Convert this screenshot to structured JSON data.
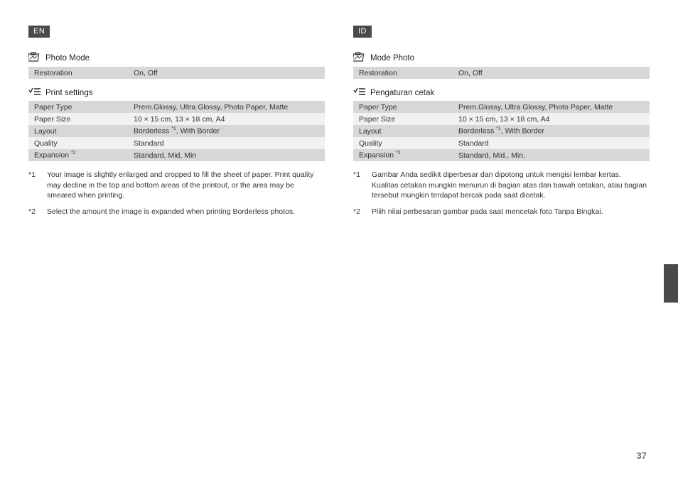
{
  "page_number": "37",
  "left": {
    "lang": "EN",
    "photo_mode": {
      "title": "Photo Mode",
      "rows": [
        {
          "label": "Restoration",
          "value": "On, Off"
        }
      ]
    },
    "print_settings": {
      "title": "Print settings",
      "rows": [
        {
          "label": "Paper Type",
          "value": "Prem.Glossy, Ultra Glossy, Photo Paper, Matte"
        },
        {
          "label": "Paper Size",
          "value": "10 × 15 cm, 13 × 18 cm, A4"
        },
        {
          "label": "Layout",
          "label_sup": "",
          "value_pre": "Borderless ",
          "value_sup": "*1",
          "value_post": ", With Border"
        },
        {
          "label": "Quality",
          "value": "Standard"
        },
        {
          "label": "Expansion ",
          "label_sup": "*2",
          "value": "Standard, Mid, Min"
        }
      ]
    },
    "footnotes": [
      {
        "marker": "*1",
        "text": "Your image is slightly enlarged and cropped to fill the sheet of paper. Print quality may decline in the top and bottom areas of the printout, or the area may be smeared when printing."
      },
      {
        "marker": "*2",
        "text": "Select the amount the image is expanded when printing Borderless photos."
      }
    ]
  },
  "right": {
    "lang": "ID",
    "photo_mode": {
      "title": "Mode Photo",
      "rows": [
        {
          "label": "Restoration",
          "value": "On, Off"
        }
      ]
    },
    "print_settings": {
      "title": "Pengaturan cetak",
      "rows": [
        {
          "label": "Paper Type",
          "value": "Prem.Glossy, Ultra Glossy, Photo Paper, Matte"
        },
        {
          "label": "Paper Size",
          "value": "10 × 15 cm, 13 × 18 cm, A4"
        },
        {
          "label": "Layout",
          "value_pre": "Borderless ",
          "value_sup": "*1",
          "value_post": ", With Border"
        },
        {
          "label": "Quality",
          "value": "Standard"
        },
        {
          "label": "Expansion ",
          "label_sup": "*2",
          "value": "Standard, Mid., Min."
        }
      ]
    },
    "footnotes": [
      {
        "marker": "*1",
        "text": "Gambar Anda sedikit diperbesar dan dipotong untuk mengisi lembar kertas. Kualitas cetakan mungkin menurun di bagian atas dan bawah cetakan, atau bagian tersebut mungkin terdapat bercak pada saat dicetak."
      },
      {
        "marker": "*2",
        "text": "Pilih nilai perbesaran gambar pada saat mencetak foto Tanpa Bingkai."
      }
    ]
  }
}
